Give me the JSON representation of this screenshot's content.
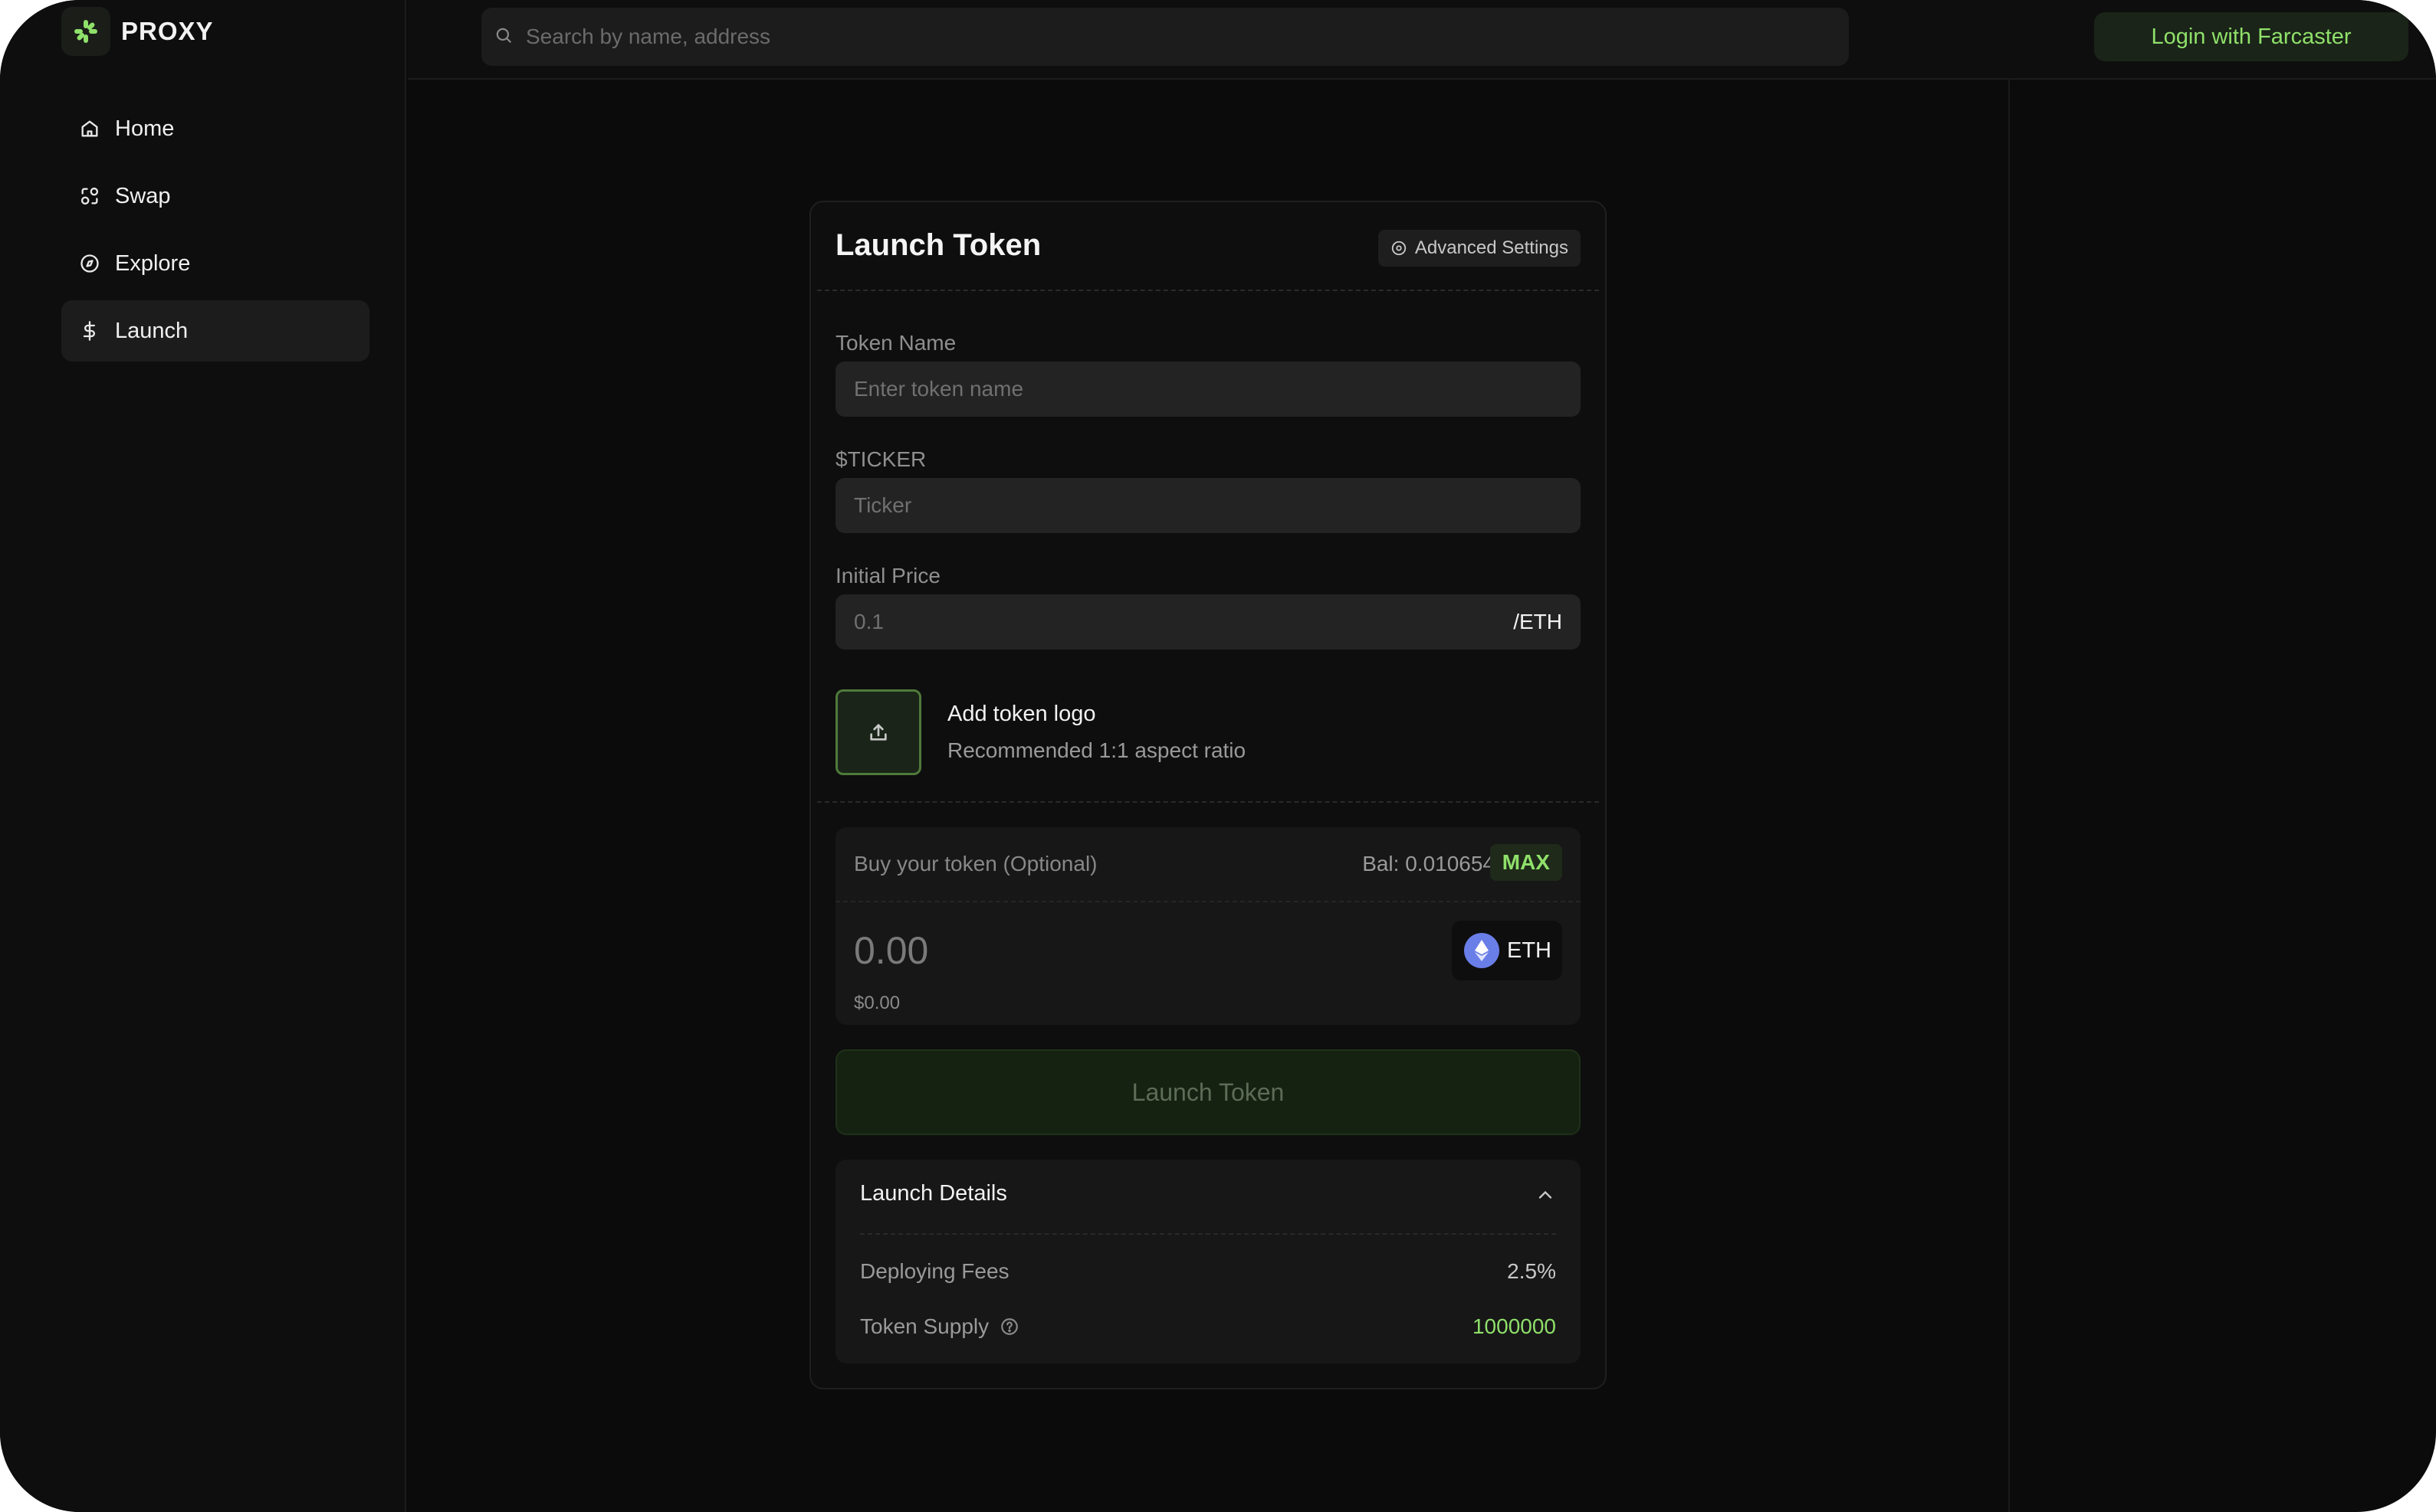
{
  "brand": {
    "name": "PROXY",
    "accent": "#8fe06a"
  },
  "sidebar": {
    "items": [
      {
        "label": "Home",
        "icon": "home-icon"
      },
      {
        "label": "Swap",
        "icon": "swap-icon"
      },
      {
        "label": "Explore",
        "icon": "compass-icon"
      },
      {
        "label": "Launch",
        "icon": "dollar-icon",
        "active": true
      }
    ]
  },
  "header": {
    "search_placeholder": "Search by name, address",
    "login_label": "Login with Farcaster"
  },
  "form": {
    "title": "Launch Token",
    "advanced_label": "Advanced Settings",
    "token_name_label": "Token Name",
    "token_name_placeholder": "Enter token name",
    "ticker_label": "$TICKER",
    "ticker_placeholder": "Ticker",
    "price_label": "Initial Price",
    "price_placeholder": "0.1",
    "price_suffix": "/ETH",
    "logo_title": "Add token logo",
    "logo_subtitle": "Recommended 1:1 aspect ratio",
    "buy": {
      "label": "Buy your token (Optional)",
      "balance": "Bal: 0.010654",
      "max_label": "MAX",
      "amount": "0.00",
      "usd_value": "$0.00",
      "currency": "ETH"
    },
    "submit_label": "Launch Token"
  },
  "details": {
    "title": "Launch Details",
    "rows": [
      {
        "label": "Deploying Fees",
        "value": "2.5%",
        "color": "#c8c8c8"
      },
      {
        "label": "Token Supply",
        "value": "1000000",
        "color": "#8fe06a"
      }
    ]
  }
}
